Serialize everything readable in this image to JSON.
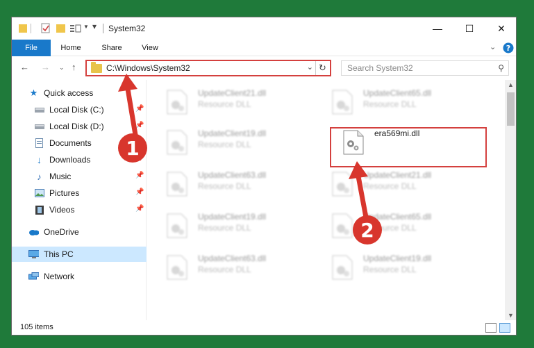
{
  "window": {
    "title": "System32",
    "controls": {
      "minimize": "—",
      "maximize": "☐",
      "close": "✕"
    }
  },
  "ribbon": {
    "tabs": [
      {
        "label": "File"
      },
      {
        "label": "Home"
      },
      {
        "label": "Share"
      },
      {
        "label": "View"
      }
    ]
  },
  "address": {
    "path": "C:\\Windows\\System32"
  },
  "search": {
    "placeholder": "Search System32"
  },
  "sidebar": {
    "items": [
      {
        "label": "Quick access",
        "icon": "star-icon",
        "pinned": false
      },
      {
        "label": "Local Disk (C:)",
        "icon": "drive-icon",
        "pinned": true
      },
      {
        "label": "Local Disk (D:)",
        "icon": "drive-icon",
        "pinned": true
      },
      {
        "label": "Documents",
        "icon": "documents-icon",
        "pinned": true
      },
      {
        "label": "Downloads",
        "icon": "download-icon",
        "pinned": true
      },
      {
        "label": "Music",
        "icon": "music-icon",
        "pinned": true
      },
      {
        "label": "Pictures",
        "icon": "pictures-icon",
        "pinned": true
      },
      {
        "label": "Videos",
        "icon": "videos-icon",
        "pinned": true
      },
      {
        "label": "OneDrive",
        "icon": "cloud-icon",
        "pinned": false
      },
      {
        "label": "This PC",
        "icon": "computer-icon",
        "pinned": false,
        "selected": true
      },
      {
        "label": "Network",
        "icon": "network-icon",
        "pinned": false
      }
    ]
  },
  "files": [
    {
      "name": "UpdateClient21.dll",
      "type": "Resource DLL",
      "blurred": true
    },
    {
      "name": "UpdateClient65.dll",
      "type": "Resource DLL",
      "blurred": true
    },
    {
      "name": "UpdateClient19.dll",
      "type": "Resource DLL",
      "blurred": true
    },
    {
      "name": "era569mi.dll",
      "type": "",
      "blurred": false,
      "highlighted": true
    },
    {
      "name": "UpdateClient63.dll",
      "type": "Resource DLL",
      "blurred": true
    },
    {
      "name": "UpdateClient21.dll",
      "type": "Resource DLL",
      "blurred": true
    },
    {
      "name": "UpdateClient19.dll",
      "type": "Resource DLL",
      "blurred": true
    },
    {
      "name": "UpdateClient65.dll",
      "type": "Resource DLL",
      "blurred": true
    },
    {
      "name": "UpdateClient63.dll",
      "type": "Resource DLL",
      "blurred": true
    },
    {
      "name": "UpdateClient19.dll",
      "type": "Resource DLL",
      "blurred": true
    }
  ],
  "status": {
    "item_count": "105 items"
  },
  "annotations": {
    "step1": "1",
    "step2": "2",
    "color": "#d8362d"
  },
  "colors": {
    "accent": "#1979ca",
    "selection": "#cce8ff",
    "highlight_border": "#d4403e"
  }
}
